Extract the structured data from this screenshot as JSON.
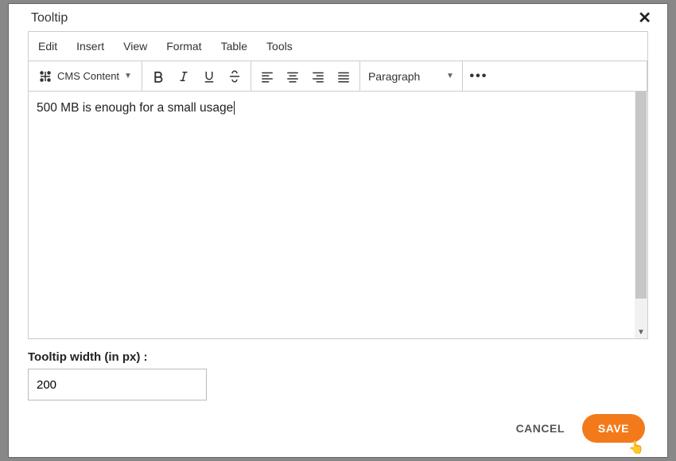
{
  "header": {
    "title": "Tooltip"
  },
  "menubar": {
    "items": [
      "Edit",
      "Insert",
      "View",
      "Format",
      "Table",
      "Tools"
    ]
  },
  "toolbar": {
    "cms_label": "CMS Content",
    "format_selected": "Paragraph"
  },
  "editor": {
    "content": "500 MB is enough for a small usage"
  },
  "tooltip_width": {
    "label": "Tooltip width (in px) :",
    "value": "200"
  },
  "footer": {
    "cancel": "CANCEL",
    "save": "SAVE"
  }
}
